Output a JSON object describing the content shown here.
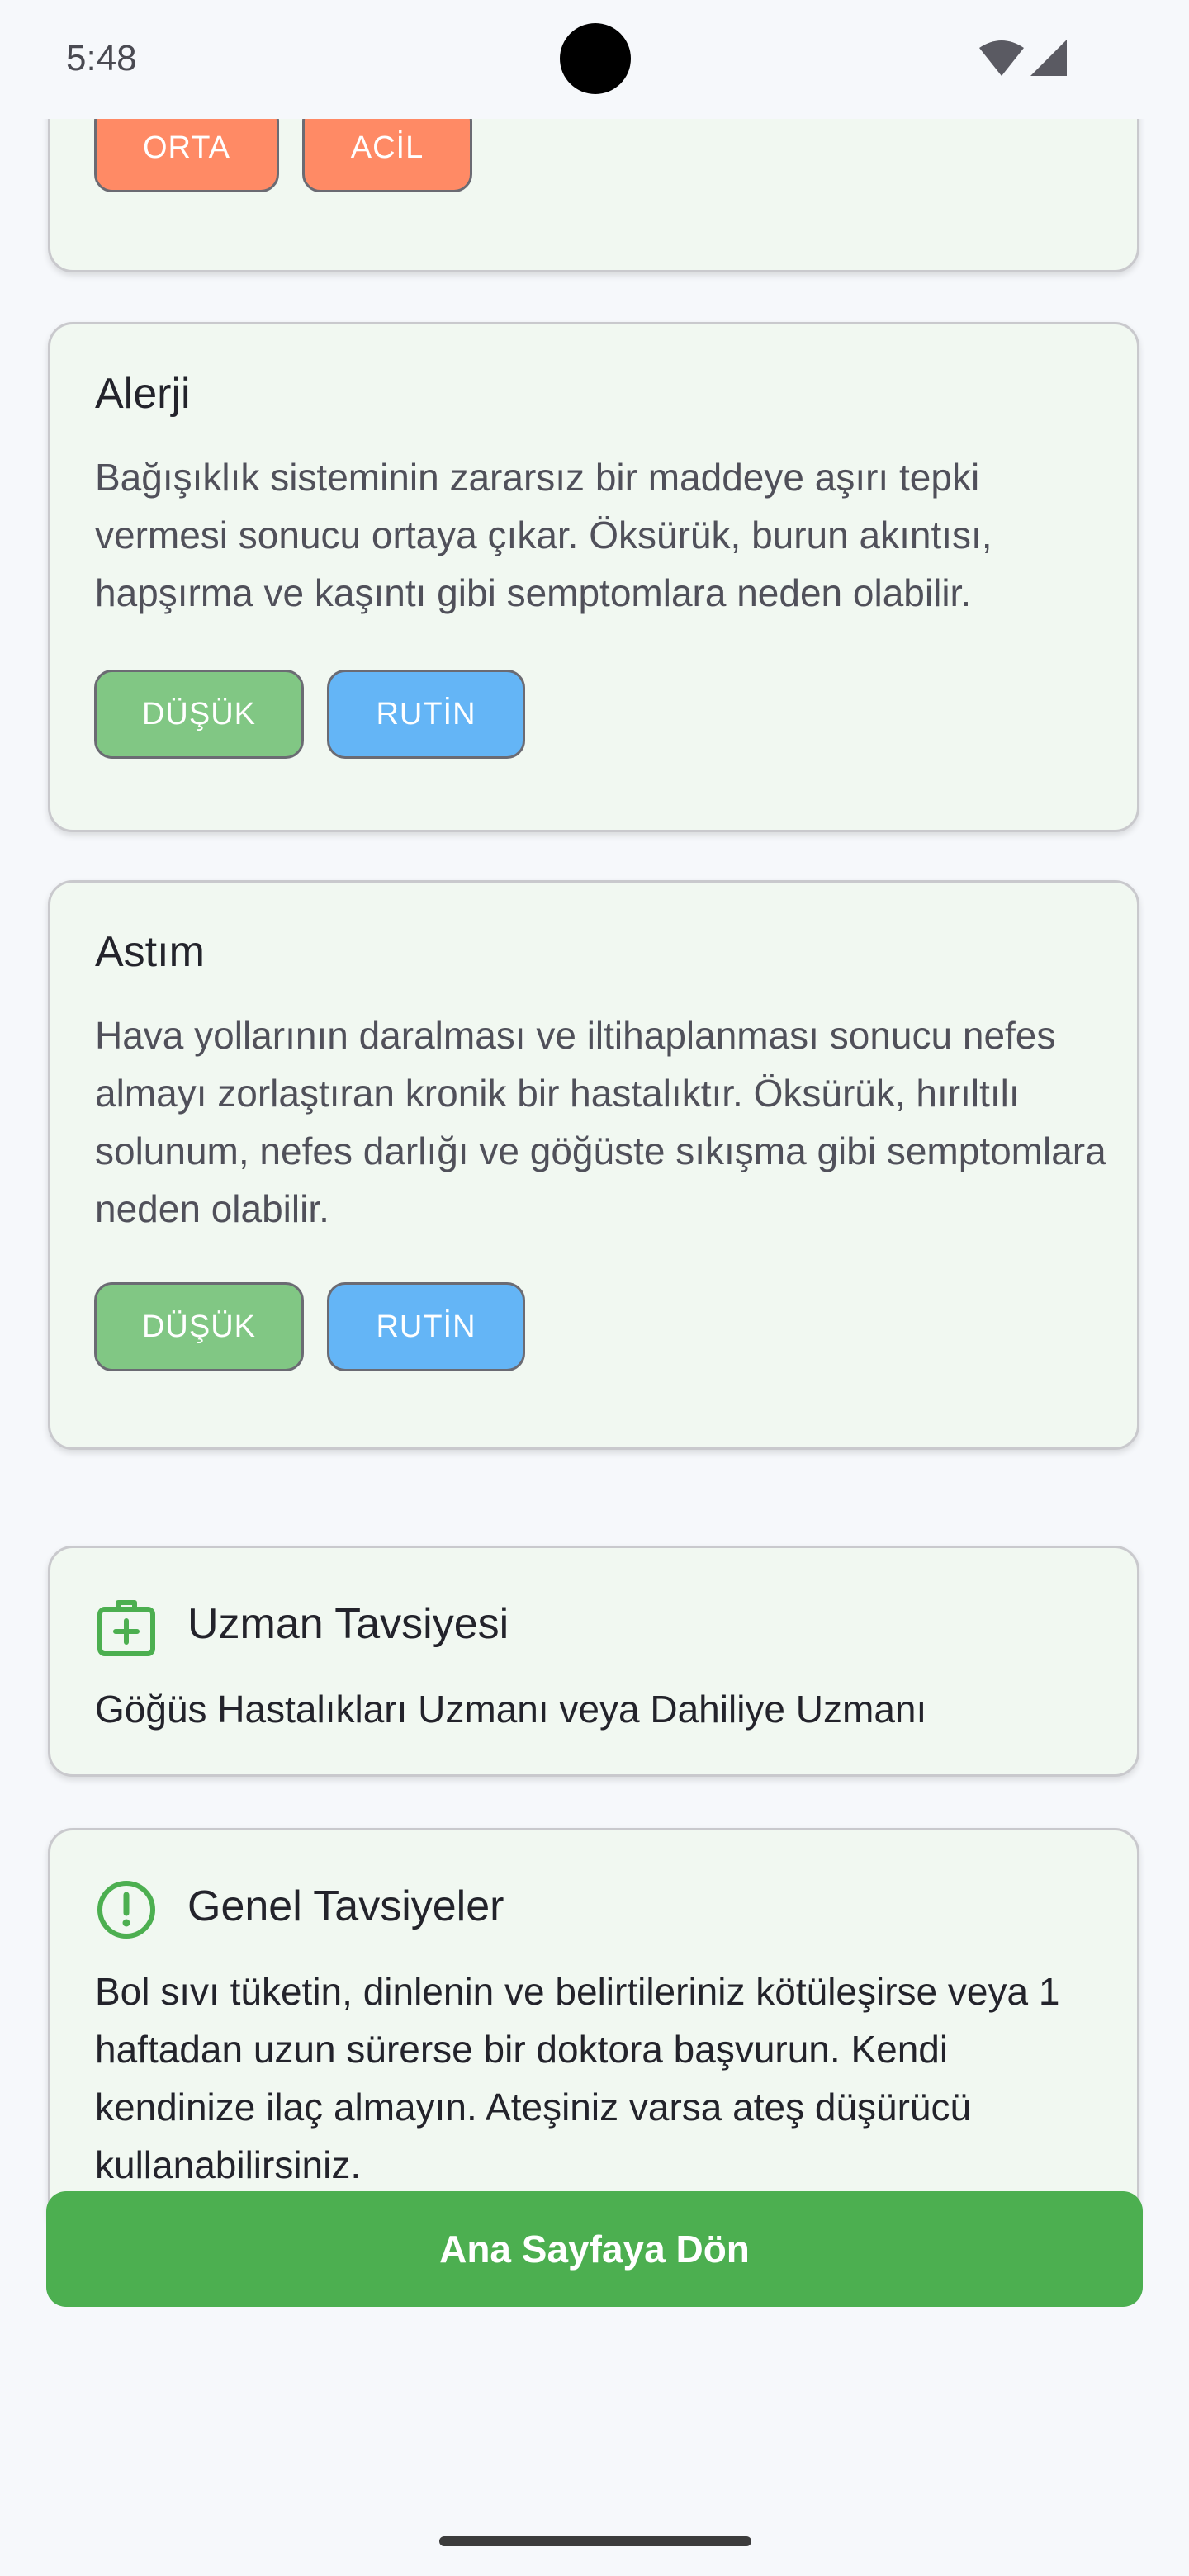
{
  "status_bar": {
    "time": "5:48"
  },
  "cards": [
    {
      "title": "",
      "description": "",
      "badges": [
        "ORTA",
        "ACİL"
      ]
    },
    {
      "title": "Alerji",
      "description": "Bağışıklık sisteminin zararsız bir maddeye aşırı tepki vermesi sonucu ortaya çıkar. Öksürük, burun akıntısı, hapşırma ve kaşıntı gibi semptomlara neden olabilir.",
      "badges": [
        "DÜŞÜK",
        "RUTİN"
      ]
    },
    {
      "title": "Astım",
      "description": "Hava yollarının daralması ve iltihaplanması sonucu nefes almayı zorlaştıran kronik bir hastalıktır. Öksürük, hırıltılı solunum, nefes darlığı ve göğüste sıkışma gibi semptomlara neden olabilir.",
      "badges": [
        "DÜŞÜK",
        "RUTİN"
      ]
    }
  ],
  "specialist": {
    "icon": "medical-kit-icon",
    "title": "Uzman Tavsiyesi",
    "text": "Göğüs Hastalıkları Uzmanı veya Dahiliye Uzmanı"
  },
  "general_advice": {
    "icon": "alert-circle-icon",
    "title": "Genel Tavsiyeler",
    "text": "Bol sıvı tüketin, dinlenin ve belirtileriniz kötüleşirse veya 1 haftadan uzun sürerse bir doktora başvurun. Kendi kendinize ilaç almayın. Ateşiniz varsa ateş düşürücü kullanabilirsiniz."
  },
  "home_button": {
    "label": "Ana Sayfaya Dön"
  },
  "colors": {
    "primary_green": "#4caf50",
    "badge_orange": "#ff8a65",
    "badge_green": "#81c784",
    "badge_blue": "#64b5f6",
    "card_background": "#f1f8f1"
  }
}
